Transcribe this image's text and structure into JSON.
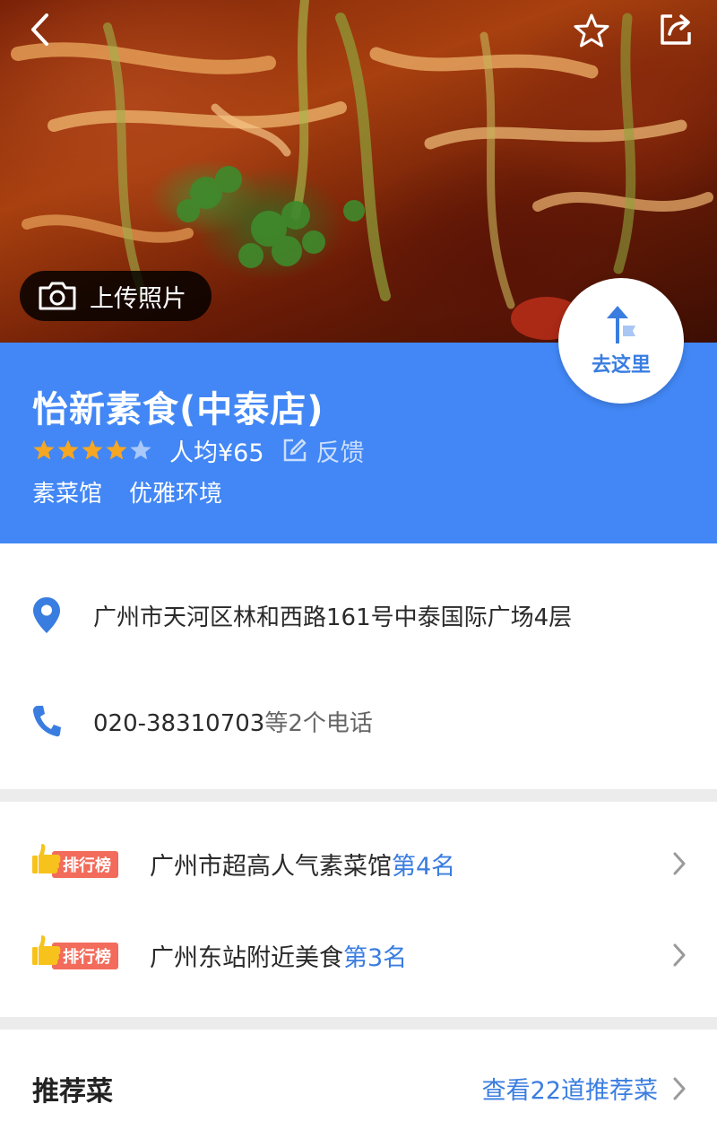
{
  "hero": {
    "upload_label": "上传照片",
    "icons": [
      "back-arrow-icon",
      "star-outline-icon",
      "share-icon",
      "camera-icon"
    ]
  },
  "shop": {
    "name": "怡新素食(中泰店)",
    "rating": 4,
    "rating_max": 5,
    "price": "人均¥65",
    "feedback_label": "反馈",
    "tags": [
      "素菜馆",
      "优雅环境"
    ],
    "go_label": "去这里"
  },
  "address": {
    "text": "广州市天河区林和西路161号中泰国际广场4层"
  },
  "phone": {
    "number": "020-38310703",
    "suffix": "等2个电话"
  },
  "rankings": [
    {
      "badge": "排行榜",
      "text": "广州市超高人气素菜馆",
      "rank": "第4名"
    },
    {
      "badge": "排行榜",
      "text": "广州东站附近美食",
      "rank": "第3名"
    }
  ],
  "recommend": {
    "title": "推荐菜",
    "link": "查看22道推荐菜"
  },
  "colors": {
    "header_blue": "#4287f5",
    "link_blue": "#3a7de0",
    "star_gold": "#f5a623",
    "badge_red": "#f26b5b"
  }
}
